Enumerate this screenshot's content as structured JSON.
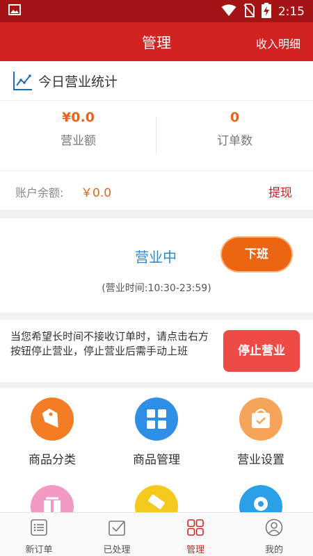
{
  "status_bar": {
    "time": "2:15",
    "icons": [
      "image-icon",
      "wifi-icon",
      "no-sim-icon",
      "battery-charging-icon"
    ]
  },
  "app_bar": {
    "title": "管理",
    "right_link": "收入明细"
  },
  "today_stats": {
    "header": "今日营业统计",
    "revenue_value": "¥0.0",
    "revenue_label": "营业额",
    "orders_value": "0",
    "orders_label": "订单数",
    "balance_label": "账户余额:",
    "balance_value": "￥0.0",
    "withdraw_label": "提现"
  },
  "business_status": {
    "status_text": "营业中",
    "offwork_button": "下班",
    "hours_text": "(营业时间:10:30-23:59)"
  },
  "stop_business": {
    "description": "当您希望长时间不接收订单时，请点击右方按钮停止营业，停止营业后需手动上班",
    "button": "停止营业"
  },
  "grid": {
    "items": [
      {
        "label": "商品分类",
        "icon": "tag-icon",
        "color": "#f47c25"
      },
      {
        "label": "商品管理",
        "icon": "grid-icon",
        "color": "#2f8fe6"
      },
      {
        "label": "营业设置",
        "icon": "shop-bag-icon",
        "color": "#f6a45a"
      },
      {
        "label": "",
        "icon": "gift-icon",
        "color": "#f29ac4"
      },
      {
        "label": "",
        "icon": "coupon-icon",
        "color": "#f6c91d"
      },
      {
        "label": "",
        "icon": "location-icon",
        "color": "#2aa0e8"
      }
    ]
  },
  "bottom_nav": {
    "items": [
      {
        "label": "新订单",
        "icon": "order-list-icon"
      },
      {
        "label": "已处理",
        "icon": "processed-icon"
      },
      {
        "label": "管理",
        "icon": "manage-icon"
      },
      {
        "label": "我的",
        "icon": "profile-icon"
      }
    ],
    "active_index": 2
  },
  "colors": {
    "status_bar": "#a51414",
    "app_bar": "#d32222",
    "accent_orange": "#e8651a",
    "accent_blue": "#2a8ad0",
    "stop_red": "#ee4a46"
  }
}
